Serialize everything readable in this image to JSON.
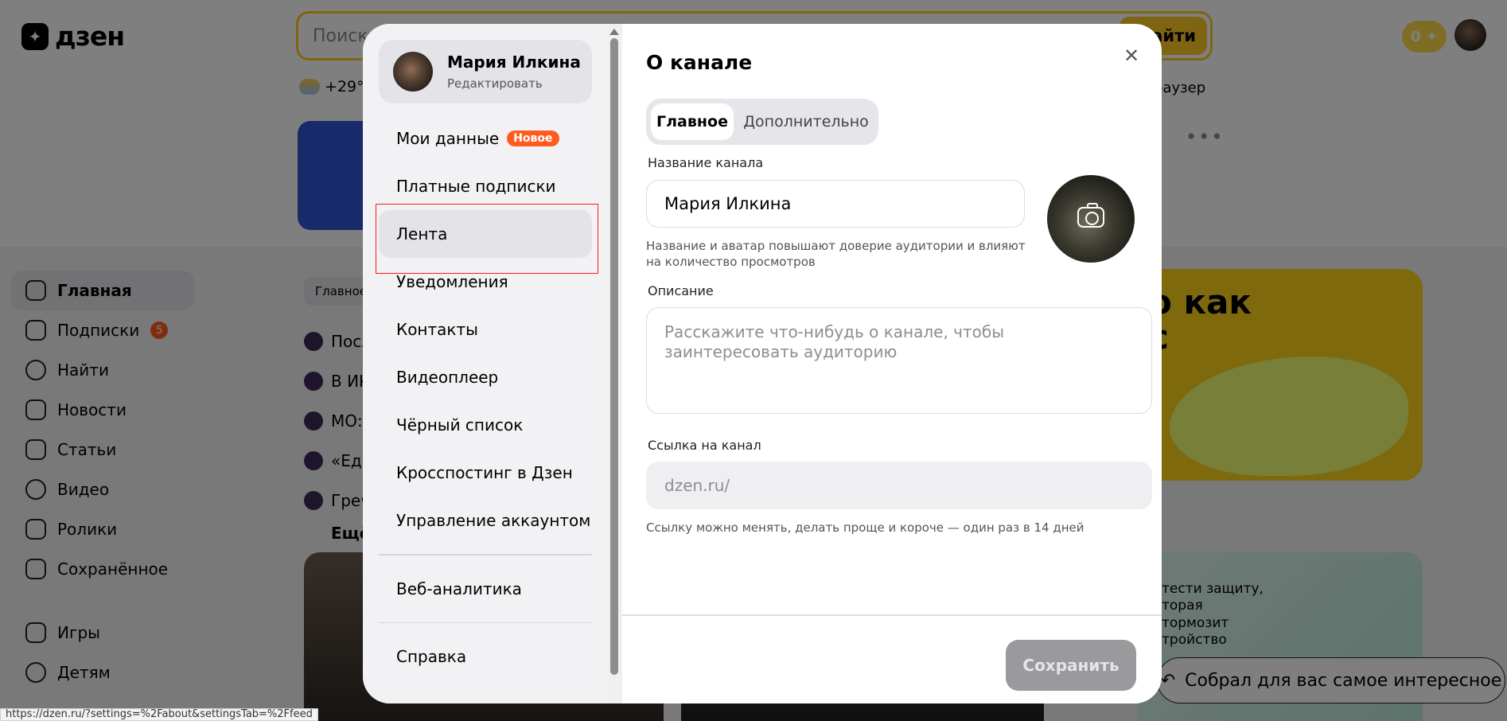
{
  "header": {
    "logo_text": "дзен",
    "search_placeholder": "Поиск",
    "search_button": "Найти",
    "coins": "0",
    "weather": "+29°",
    "browser_link": "раузер"
  },
  "side_nav": {
    "items": [
      {
        "label": "Главная",
        "icon": "home-icon",
        "active": true
      },
      {
        "label": "Подписки",
        "icon": "subscriptions-icon",
        "badge": "5"
      },
      {
        "label": "Найти",
        "icon": "search-icon"
      },
      {
        "label": "Новости",
        "icon": "news-icon"
      },
      {
        "label": "Статьи",
        "icon": "articles-icon"
      },
      {
        "label": "Видео",
        "icon": "video-icon"
      },
      {
        "label": "Ролики",
        "icon": "shorts-icon"
      },
      {
        "label": "Сохранённое",
        "icon": "bookmark-icon"
      }
    ],
    "items_bottom": [
      {
        "label": "Игры",
        "icon": "gamepad-icon"
      },
      {
        "label": "Детям",
        "icon": "kids-icon"
      }
    ]
  },
  "feed": {
    "chip": "Главное",
    "rows": [
      "Посл",
      "В ИК",
      "МО:",
      "«Еди",
      "Греч"
    ],
    "more": "Ещё"
  },
  "promo": {
    "yellow_text": "о как\nс",
    "card_text": "тести защиту,\nторая\nтормозит\nтройство"
  },
  "toast": {
    "text": "Собрал для вас самое интересное"
  },
  "status_url": "https://dzen.ru/?settings=%2Fabout&settingsTab=%2Ffeed",
  "modal": {
    "profile": {
      "name": "Мария Илкина",
      "edit": "Редактировать"
    },
    "menu": [
      {
        "label": "Мои данные",
        "badge": "Новое"
      },
      {
        "label": "Платные подписки"
      },
      {
        "label": "Лента",
        "active": true
      },
      {
        "label": "Уведомления"
      },
      {
        "label": "Контакты"
      },
      {
        "label": "Видеоплеер"
      },
      {
        "label": "Чёрный список"
      },
      {
        "label": "Кросспостинг в Дзен"
      },
      {
        "label": "Управление аккаунтом"
      }
    ],
    "menu_bottom": [
      "Веб-аналитика",
      "Справка"
    ],
    "title": "О канале",
    "tabs": [
      "Главное",
      "Дополнительно"
    ],
    "channel_name_label": "Название канала",
    "channel_name_value": "Мария Илкина",
    "channel_name_hint": "Название и аватар повышают доверие аудитории и влияют на количество просмотров",
    "description_label": "Описание",
    "description_placeholder": "Расскажите что-нибудь о канале, чтобы заинтересовать аудиторию",
    "link_label": "Ссылка на канал",
    "link_value": "dzen.ru/",
    "link_hint": "Ссылку можно менять, делать проще и короче — один раз в 14 дней",
    "save_button": "Сохранить"
  }
}
